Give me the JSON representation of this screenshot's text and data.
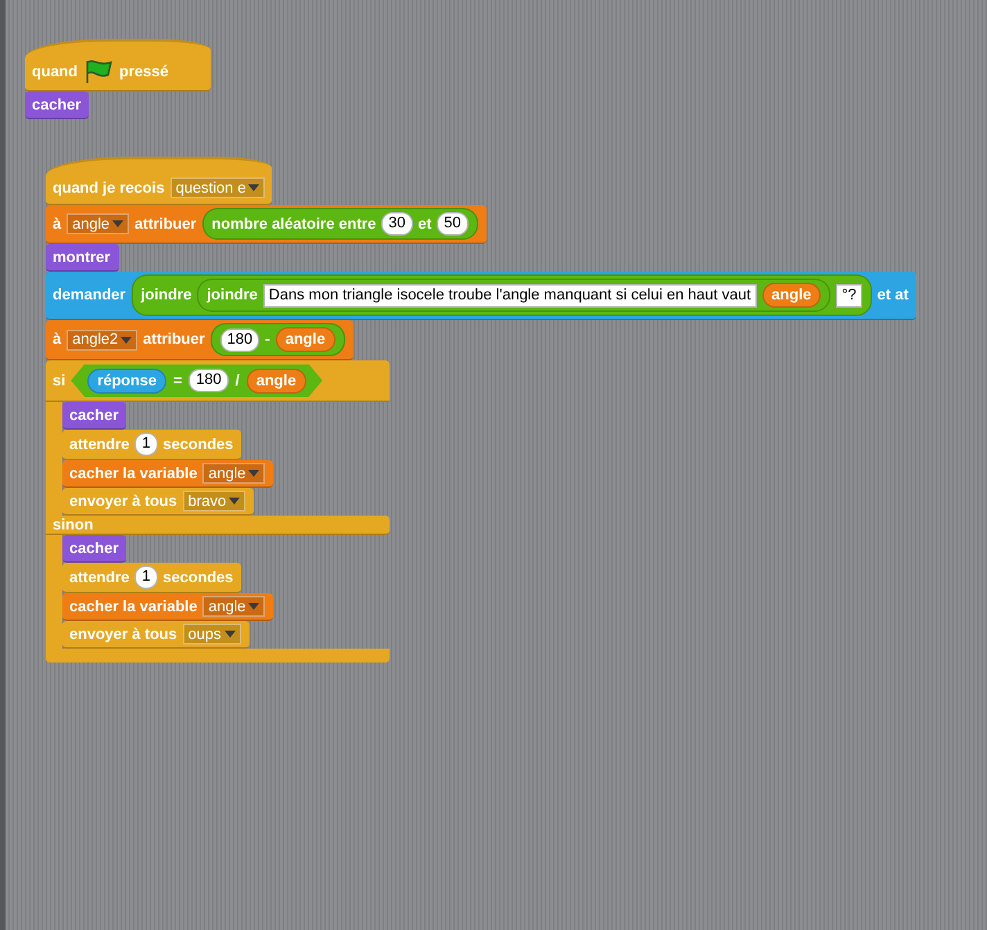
{
  "scripts": [
    {
      "blocks": [
        {
          "kind": "hat",
          "color": "#e6a822",
          "parts": [
            {
              "kind": "label",
              "text": "quand"
            },
            {
              "kind": "flag"
            },
            {
              "kind": "label",
              "text": "pressé"
            }
          ]
        },
        {
          "kind": "stack",
          "color": "#8a55d7",
          "parts": [
            {
              "kind": "label",
              "text": "cacher"
            }
          ]
        }
      ]
    },
    {
      "blocks": [
        {
          "kind": "hat",
          "color": "#e6a822",
          "parts": [
            {
              "kind": "label",
              "text": "quand je recois"
            },
            {
              "kind": "dropdown",
              "text": "question e"
            }
          ]
        },
        {
          "kind": "stack",
          "color": "#ee7d16",
          "parts": [
            {
              "kind": "label",
              "text": "à"
            },
            {
              "kind": "dropdown",
              "text": "angle"
            },
            {
              "kind": "label",
              "text": "attribuer"
            },
            {
              "kind": "reporter",
              "color": "#5cb712",
              "parts": [
                {
                  "kind": "label",
                  "text": "nombre aléatoire entre"
                },
                {
                  "kind": "number",
                  "text": "30"
                },
                {
                  "kind": "label",
                  "text": "et"
                },
                {
                  "kind": "number",
                  "text": "50"
                }
              ]
            }
          ]
        },
        {
          "kind": "stack",
          "color": "#8a55d7",
          "parts": [
            {
              "kind": "label",
              "text": "montrer"
            }
          ]
        },
        {
          "kind": "stack",
          "color": "#2ca5e2",
          "parts": [
            {
              "kind": "label",
              "text": "demander"
            },
            {
              "kind": "reporter",
              "color": "#5cb712",
              "parts": [
                {
                  "kind": "label",
                  "text": "joindre"
                },
                {
                  "kind": "reporter",
                  "color": "#5cb712",
                  "parts": [
                    {
                      "kind": "label",
                      "text": "joindre"
                    },
                    {
                      "kind": "string",
                      "text": "Dans mon triangle isocele troube l'angle manquant si celui en haut vaut"
                    },
                    {
                      "kind": "reporter",
                      "color": "#ee7d16",
                      "parts": [
                        {
                          "kind": "label",
                          "text": "angle"
                        }
                      ]
                    }
                  ]
                },
                {
                  "kind": "string",
                  "text": "°?"
                }
              ]
            },
            {
              "kind": "label",
              "text": "et at"
            }
          ]
        },
        {
          "kind": "stack",
          "color": "#ee7d16",
          "parts": [
            {
              "kind": "label",
              "text": "à"
            },
            {
              "kind": "dropdown",
              "text": "angle2"
            },
            {
              "kind": "label",
              "text": "attribuer"
            },
            {
              "kind": "reporter",
              "color": "#5cb712",
              "parts": [
                {
                  "kind": "number",
                  "text": "180"
                },
                {
                  "kind": "label",
                  "text": "-"
                },
                {
                  "kind": "reporter",
                  "color": "#ee7d16",
                  "parts": [
                    {
                      "kind": "label",
                      "text": "angle"
                    }
                  ]
                }
              ]
            }
          ]
        },
        {
          "kind": "if_else",
          "color": "#e6a822",
          "parts": [
            {
              "kind": "label",
              "text": "si"
            },
            {
              "kind": "boolean",
              "color": "#5cb712",
              "parts": [
                {
                  "kind": "reporter",
                  "color": "#2ca5e2",
                  "parts": [
                    {
                      "kind": "label",
                      "text": "réponse"
                    }
                  ]
                },
                {
                  "kind": "label",
                  "text": "="
                },
                {
                  "kind": "number",
                  "text": "180"
                },
                {
                  "kind": "label",
                  "text": "/"
                },
                {
                  "kind": "reporter",
                  "color": "#ee7d16",
                  "parts": [
                    {
                      "kind": "label",
                      "text": "angle"
                    }
                  ]
                }
              ]
            }
          ],
          "then": [
            {
              "kind": "stack",
              "color": "#8a55d7",
              "parts": [
                {
                  "kind": "label",
                  "text": "cacher"
                }
              ]
            },
            {
              "kind": "stack",
              "color": "#e6a822",
              "parts": [
                {
                  "kind": "label",
                  "text": "attendre"
                },
                {
                  "kind": "number",
                  "text": "1"
                },
                {
                  "kind": "label",
                  "text": "secondes"
                }
              ]
            },
            {
              "kind": "stack",
              "color": "#ee7d16",
              "parts": [
                {
                  "kind": "label",
                  "text": "cacher la variable"
                },
                {
                  "kind": "dropdown",
                  "text": "angle"
                }
              ]
            },
            {
              "kind": "stack",
              "color": "#e6a822",
              "parts": [
                {
                  "kind": "label",
                  "text": "envoyer à tous"
                },
                {
                  "kind": "dropdown",
                  "text": "bravo"
                }
              ]
            }
          ],
          "else_label": "sinon",
          "else": [
            {
              "kind": "stack",
              "color": "#8a55d7",
              "parts": [
                {
                  "kind": "label",
                  "text": "cacher"
                }
              ]
            },
            {
              "kind": "stack",
              "color": "#e6a822",
              "parts": [
                {
                  "kind": "label",
                  "text": "attendre"
                },
                {
                  "kind": "number",
                  "text": "1"
                },
                {
                  "kind": "label",
                  "text": "secondes"
                }
              ]
            },
            {
              "kind": "stack",
              "color": "#ee7d16",
              "parts": [
                {
                  "kind": "label",
                  "text": "cacher la variable"
                },
                {
                  "kind": "dropdown",
                  "text": "angle"
                }
              ]
            },
            {
              "kind": "stack",
              "color": "#e6a822",
              "parts": [
                {
                  "kind": "label",
                  "text": "envoyer à tous"
                },
                {
                  "kind": "dropdown",
                  "text": "oups"
                }
              ]
            }
          ]
        }
      ]
    }
  ]
}
